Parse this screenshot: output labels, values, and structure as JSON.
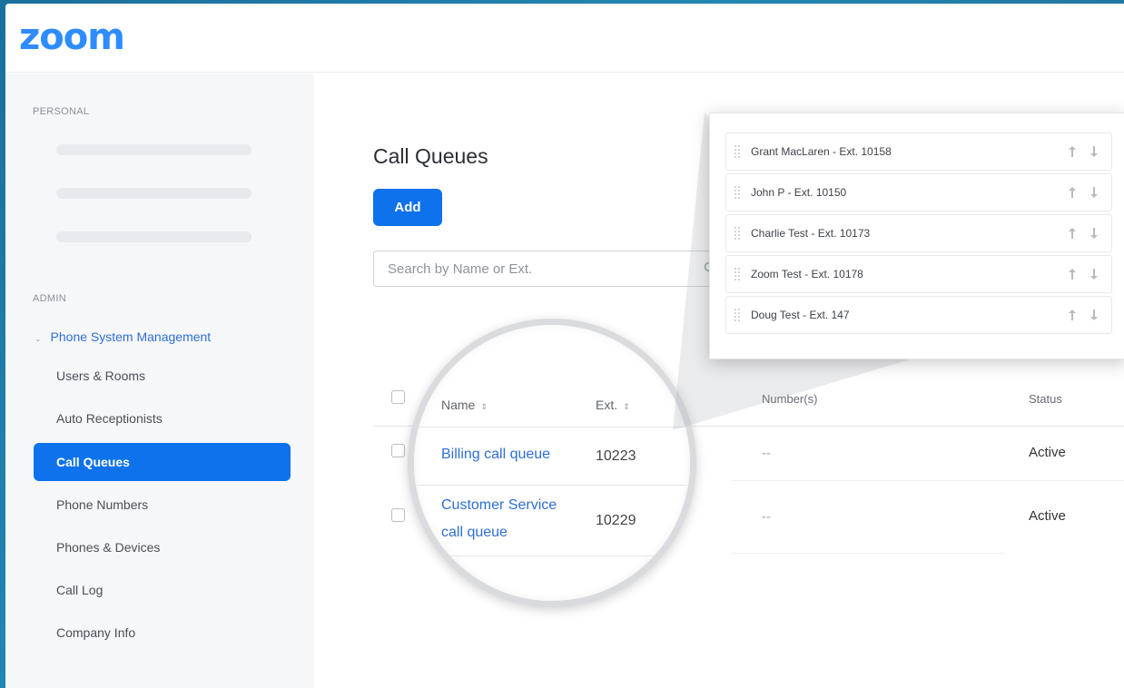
{
  "app": {
    "logo": "zoom",
    "accent_color": "#0e72ed"
  },
  "sidebar": {
    "personal_label": "PERSONAL",
    "admin_label": "ADMIN",
    "parent_item": "Phone System Management",
    "items": [
      {
        "label": "Users & Rooms",
        "active": false
      },
      {
        "label": "Auto Receptionists",
        "active": false
      },
      {
        "label": "Call Queues",
        "active": true
      },
      {
        "label": "Phone Numbers",
        "active": false
      },
      {
        "label": "Phones & Devices",
        "active": false
      },
      {
        "label": "Call Log",
        "active": false
      },
      {
        "label": "Company Info",
        "active": false
      }
    ]
  },
  "main": {
    "title": "Call Queues",
    "add_label": "Add",
    "search_placeholder": "Search by Name or Ext.",
    "columns": {
      "name": "Name",
      "ext": "Ext.",
      "numbers": "Number(s)",
      "status": "Status"
    },
    "rows": [
      {
        "name": "Billing call queue",
        "ext": "10223",
        "numbers": "--",
        "status": "Active"
      },
      {
        "name_line1": "Customer Service",
        "name_line2": "call queue",
        "ext": "10229",
        "numbers": "--",
        "status": "Active"
      }
    ]
  },
  "popup": {
    "members": [
      "Grant MacLaren - Ext. 10158",
      "John P - Ext. 10150",
      "Charlie Test - Ext. 10173",
      "Zoom Test - Ext. 10178",
      "Doug Test - Ext. 147"
    ]
  }
}
